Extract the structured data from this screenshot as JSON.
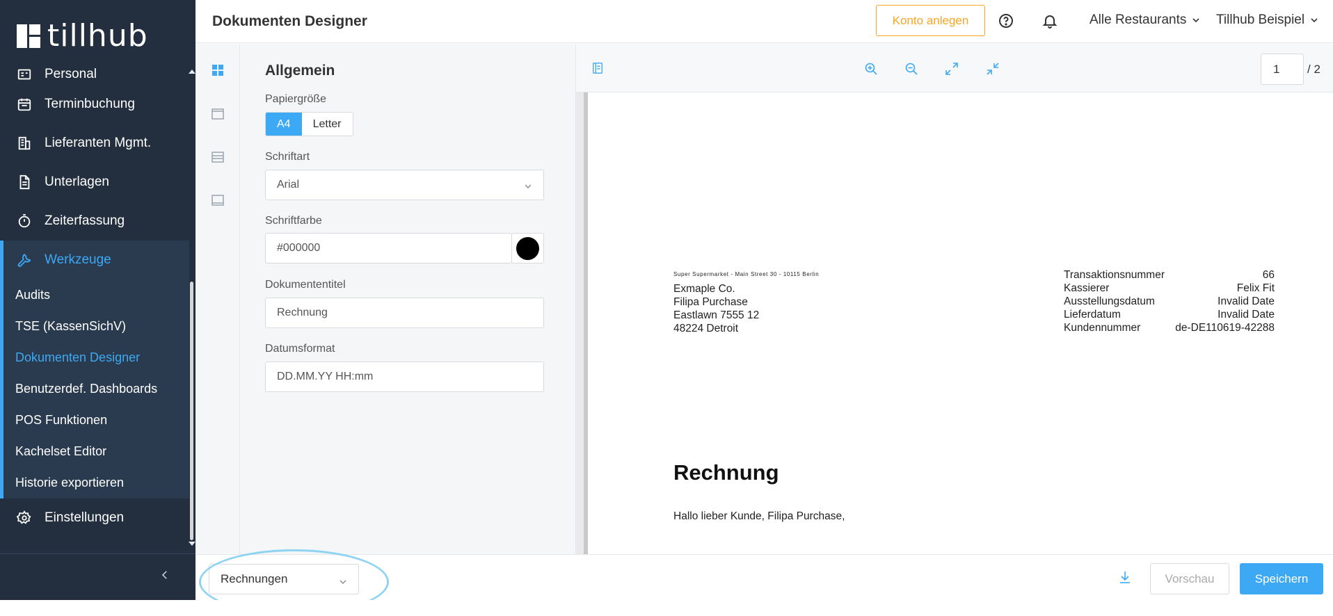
{
  "brand": {
    "name": "tillhub"
  },
  "sidebar": {
    "items": [
      {
        "label": "Personal",
        "icon": "id-card-icon"
      },
      {
        "label": "Terminbuchung",
        "icon": "calendar-icon"
      },
      {
        "label": "Lieferanten Mgmt.",
        "icon": "building-icon"
      },
      {
        "label": "Unterlagen",
        "icon": "document-icon"
      },
      {
        "label": "Zeiterfassung",
        "icon": "stopwatch-icon"
      },
      {
        "label": "Werkzeuge",
        "icon": "wrench-icon"
      }
    ],
    "sub_items": [
      {
        "label": "Audits"
      },
      {
        "label": "TSE (KassenSichV)"
      },
      {
        "label": "Dokumenten Designer"
      },
      {
        "label": "Benutzerdef. Dashboards"
      },
      {
        "label": "POS Funktionen"
      },
      {
        "label": "Kachelset Editor"
      },
      {
        "label": "Historie exportieren"
      }
    ],
    "settings": {
      "label": "Einstellungen",
      "icon": "gear-icon"
    }
  },
  "header": {
    "title": "Dokumenten Designer",
    "konto_button": "Konto anlegen",
    "location_dropdown": "Alle Restaurants",
    "account_dropdown": "Tillhub Beispiel"
  },
  "form": {
    "section_title": "Allgemein",
    "paper_size": {
      "label": "Papiergröße",
      "options": [
        "A4",
        "Letter"
      ],
      "selected": "A4"
    },
    "font": {
      "label": "Schriftart",
      "value": "Arial"
    },
    "font_color": {
      "label": "Schriftfarbe",
      "value": "#000000"
    },
    "doc_title": {
      "label": "Dokumententitel",
      "value": "Rechnung"
    },
    "date_format": {
      "label": "Datumsformat",
      "value": "DD.MM.YY HH:mm"
    }
  },
  "preview": {
    "page_current": "1",
    "page_total": "/ 2",
    "sender_line": "Super Supermarket - Main Street 30 - 10115 Berlin",
    "address_lines": [
      "Exmaple Co.",
      "Filipa Purchase",
      "Eastlawn 7555 12",
      "48224 Detroit"
    ],
    "meta": [
      {
        "key": "Transaktionsnummer",
        "value": "66"
      },
      {
        "key": "Kassierer",
        "value": "Felix Fit"
      },
      {
        "key": "Ausstellungsdatum",
        "value": "Invalid Date"
      },
      {
        "key": "Lieferdatum",
        "value": "Invalid Date"
      },
      {
        "key": "Kundennummer",
        "value": "de-DE110619-42288"
      }
    ],
    "title": "Rechnung",
    "greeting": "Hallo lieber Kunde, Filipa Purchase,"
  },
  "bottom": {
    "doc_type": "Rechnungen",
    "preview_button": "Vorschau",
    "save_button": "Speichern"
  },
  "colors": {
    "sidebar_bg": "#232f3e",
    "accent": "#3da9f4",
    "konto_accent": "#f5a623",
    "highlight": "#8fd3f3"
  }
}
